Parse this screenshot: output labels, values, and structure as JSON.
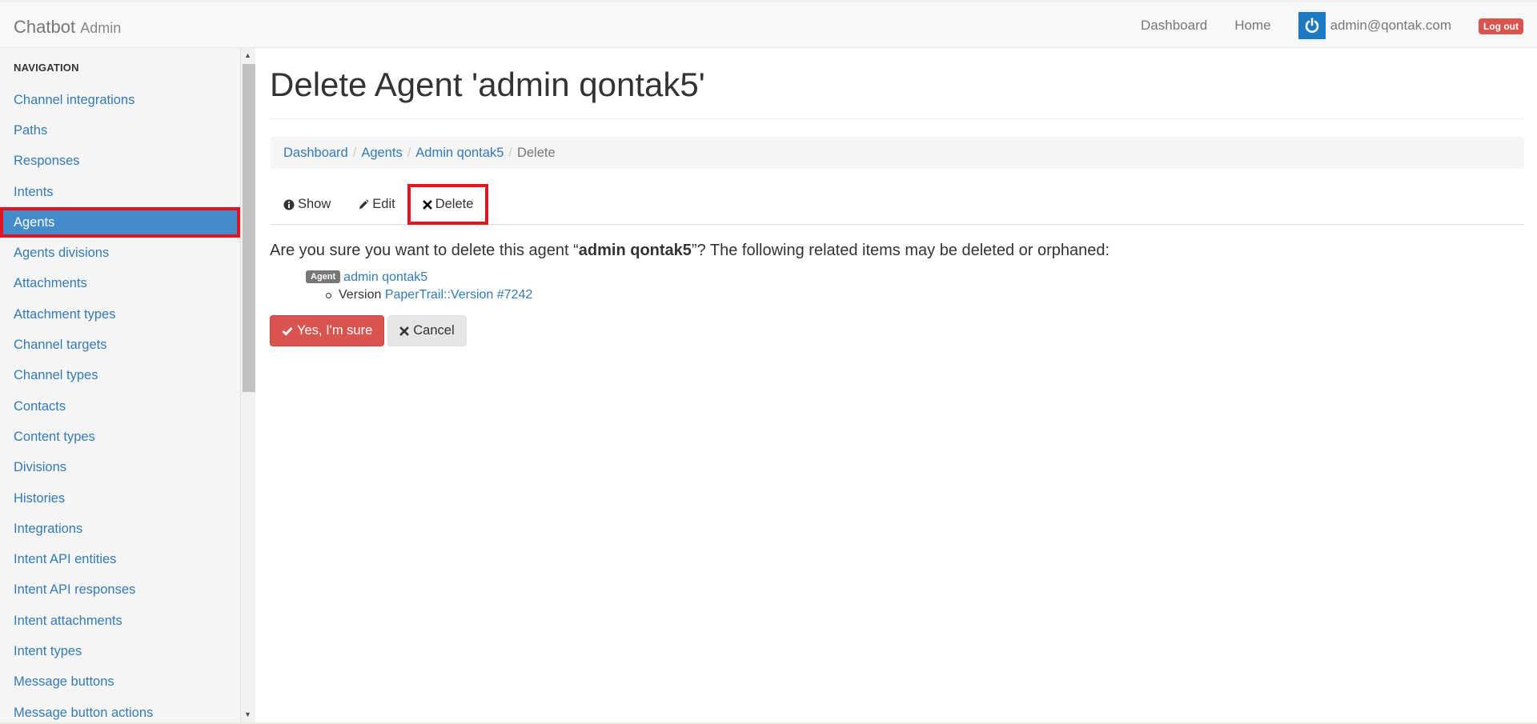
{
  "navbar": {
    "brand": "Chatbot",
    "brand_sub": "Admin",
    "links": {
      "dashboard": "Dashboard",
      "home": "Home"
    },
    "user_email": "admin@qontak.com",
    "logout": "Log out",
    "avatar_color": "#1d7ac2"
  },
  "sidebar": {
    "header": "Navigation",
    "items": [
      {
        "label": "Channel integrations"
      },
      {
        "label": "Paths"
      },
      {
        "label": "Responses"
      },
      {
        "label": "Intents"
      },
      {
        "label": "Agents",
        "active": true
      },
      {
        "label": "Agents divisions"
      },
      {
        "label": "Attachments"
      },
      {
        "label": "Attachment types"
      },
      {
        "label": "Channel targets"
      },
      {
        "label": "Channel types"
      },
      {
        "label": "Contacts"
      },
      {
        "label": "Content types"
      },
      {
        "label": "Divisions"
      },
      {
        "label": "Histories"
      },
      {
        "label": "Integrations"
      },
      {
        "label": "Intent API entities"
      },
      {
        "label": "Intent API responses"
      },
      {
        "label": "Intent attachments"
      },
      {
        "label": "Intent types"
      },
      {
        "label": "Message buttons"
      },
      {
        "label": "Message button actions"
      }
    ]
  },
  "main": {
    "title": "Delete Agent 'admin qontak5'",
    "breadcrumb": [
      {
        "label": "Dashboard"
      },
      {
        "label": "Agents"
      },
      {
        "label": "Admin qontak5"
      },
      {
        "label": "Delete"
      }
    ],
    "tabs": {
      "show": "Show",
      "edit": "Edit",
      "delete": "Delete"
    },
    "confirm": {
      "prefix": "Are you sure you want to delete this agent “",
      "name": "admin qontak5",
      "suffix": "”? The following related items may be deleted or orphaned:"
    },
    "related": {
      "badge": "Agent",
      "link": "admin qontak5",
      "version_label": "Version",
      "version_link": "PaperTrail::Version #7242"
    },
    "buttons": {
      "confirm": "Yes, I'm sure",
      "cancel": "Cancel"
    }
  },
  "colors": {
    "link": "#337ab7",
    "danger": "#d9534f",
    "active_nav": "#428bca",
    "highlight": "#e3141f"
  }
}
